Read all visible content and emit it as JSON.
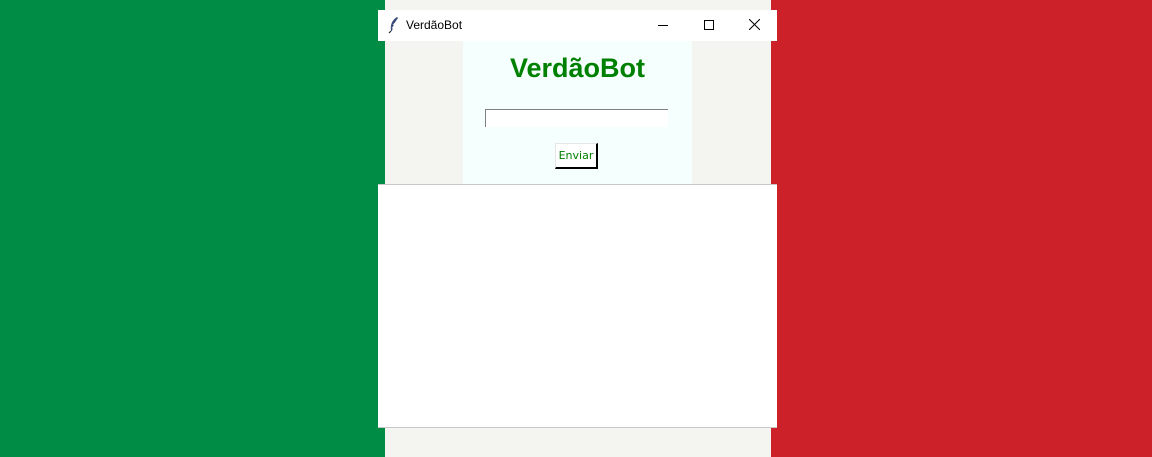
{
  "window": {
    "title": "VerdãoBot",
    "icon": "feather-icon"
  },
  "titlebar_buttons": {
    "minimize": "minimize-icon",
    "maximize": "maximize-icon",
    "close": "close-icon"
  },
  "app": {
    "title": "VerdãoBot",
    "input_value": "",
    "send_label": "Enviar",
    "output_text": ""
  },
  "colors": {
    "flag_green": "#008C45",
    "flag_white": "#F4F5F0",
    "flag_red": "#CD212A",
    "panel_bg": "#F5FFFD",
    "accent_green": "#008000"
  }
}
